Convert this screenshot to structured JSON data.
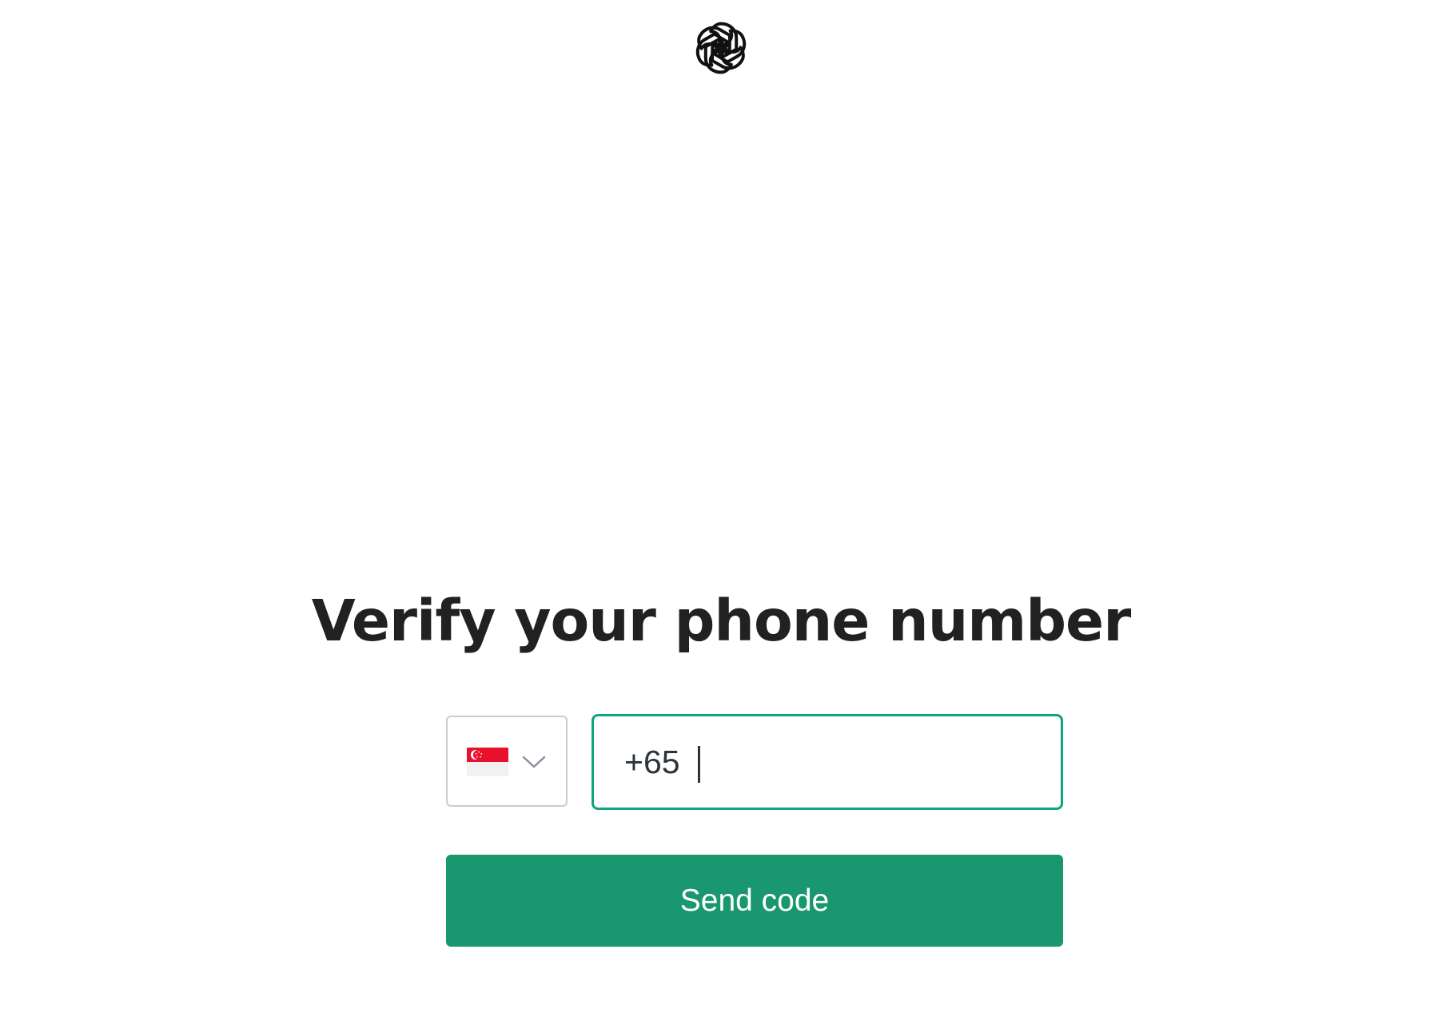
{
  "header": {
    "logo_icon": "openai-logo-icon"
  },
  "main": {
    "title": "Verify your phone number",
    "country_select": {
      "selected_country_flag": "singapore-flag-icon",
      "chevron_icon": "chevron-down-icon"
    },
    "phone_input": {
      "value": "+65 "
    },
    "send_button": {
      "label": "Send code"
    }
  },
  "colors": {
    "accent": "#10a37f",
    "button_bg": "#19976f",
    "title_text": "#202123",
    "border_neutral": "#c9ccd1",
    "flag_red": "#e8112d"
  }
}
